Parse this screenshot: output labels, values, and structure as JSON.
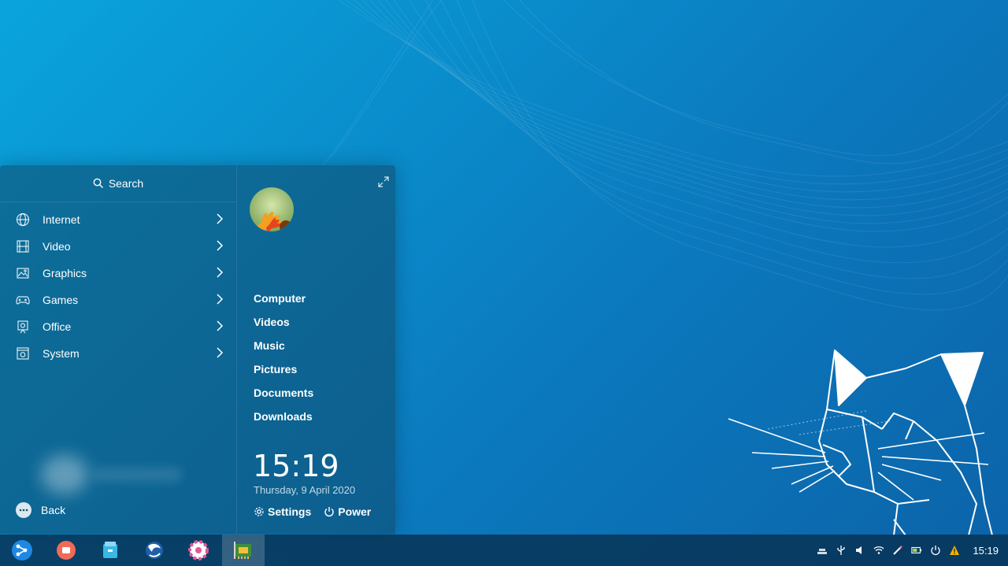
{
  "search": {
    "label": "Search"
  },
  "categories": [
    {
      "label": "Internet",
      "icon": "globe-icon"
    },
    {
      "label": "Video",
      "icon": "film-icon"
    },
    {
      "label": "Graphics",
      "icon": "image-icon"
    },
    {
      "label": "Games",
      "icon": "gamepad-icon"
    },
    {
      "label": "Office",
      "icon": "office-icon"
    },
    {
      "label": "System",
      "icon": "system-icon"
    }
  ],
  "back_label": "Back",
  "places": [
    "Computer",
    "Videos",
    "Music",
    "Pictures",
    "Documents",
    "Downloads"
  ],
  "clock": {
    "time": "15:19",
    "date": "Thursday, 9 April 2020"
  },
  "actions": {
    "settings": "Settings",
    "power": "Power"
  },
  "taskbar": {
    "apps": [
      "launcher-icon",
      "screen-recorder-icon",
      "file-manager-icon",
      "browser-icon",
      "settings-icon",
      "system-monitor-icon"
    ],
    "tray_time": "15:19"
  },
  "colors": {
    "accent": "#1e88e5",
    "panel": "#104868",
    "warning": "#f5b400"
  }
}
